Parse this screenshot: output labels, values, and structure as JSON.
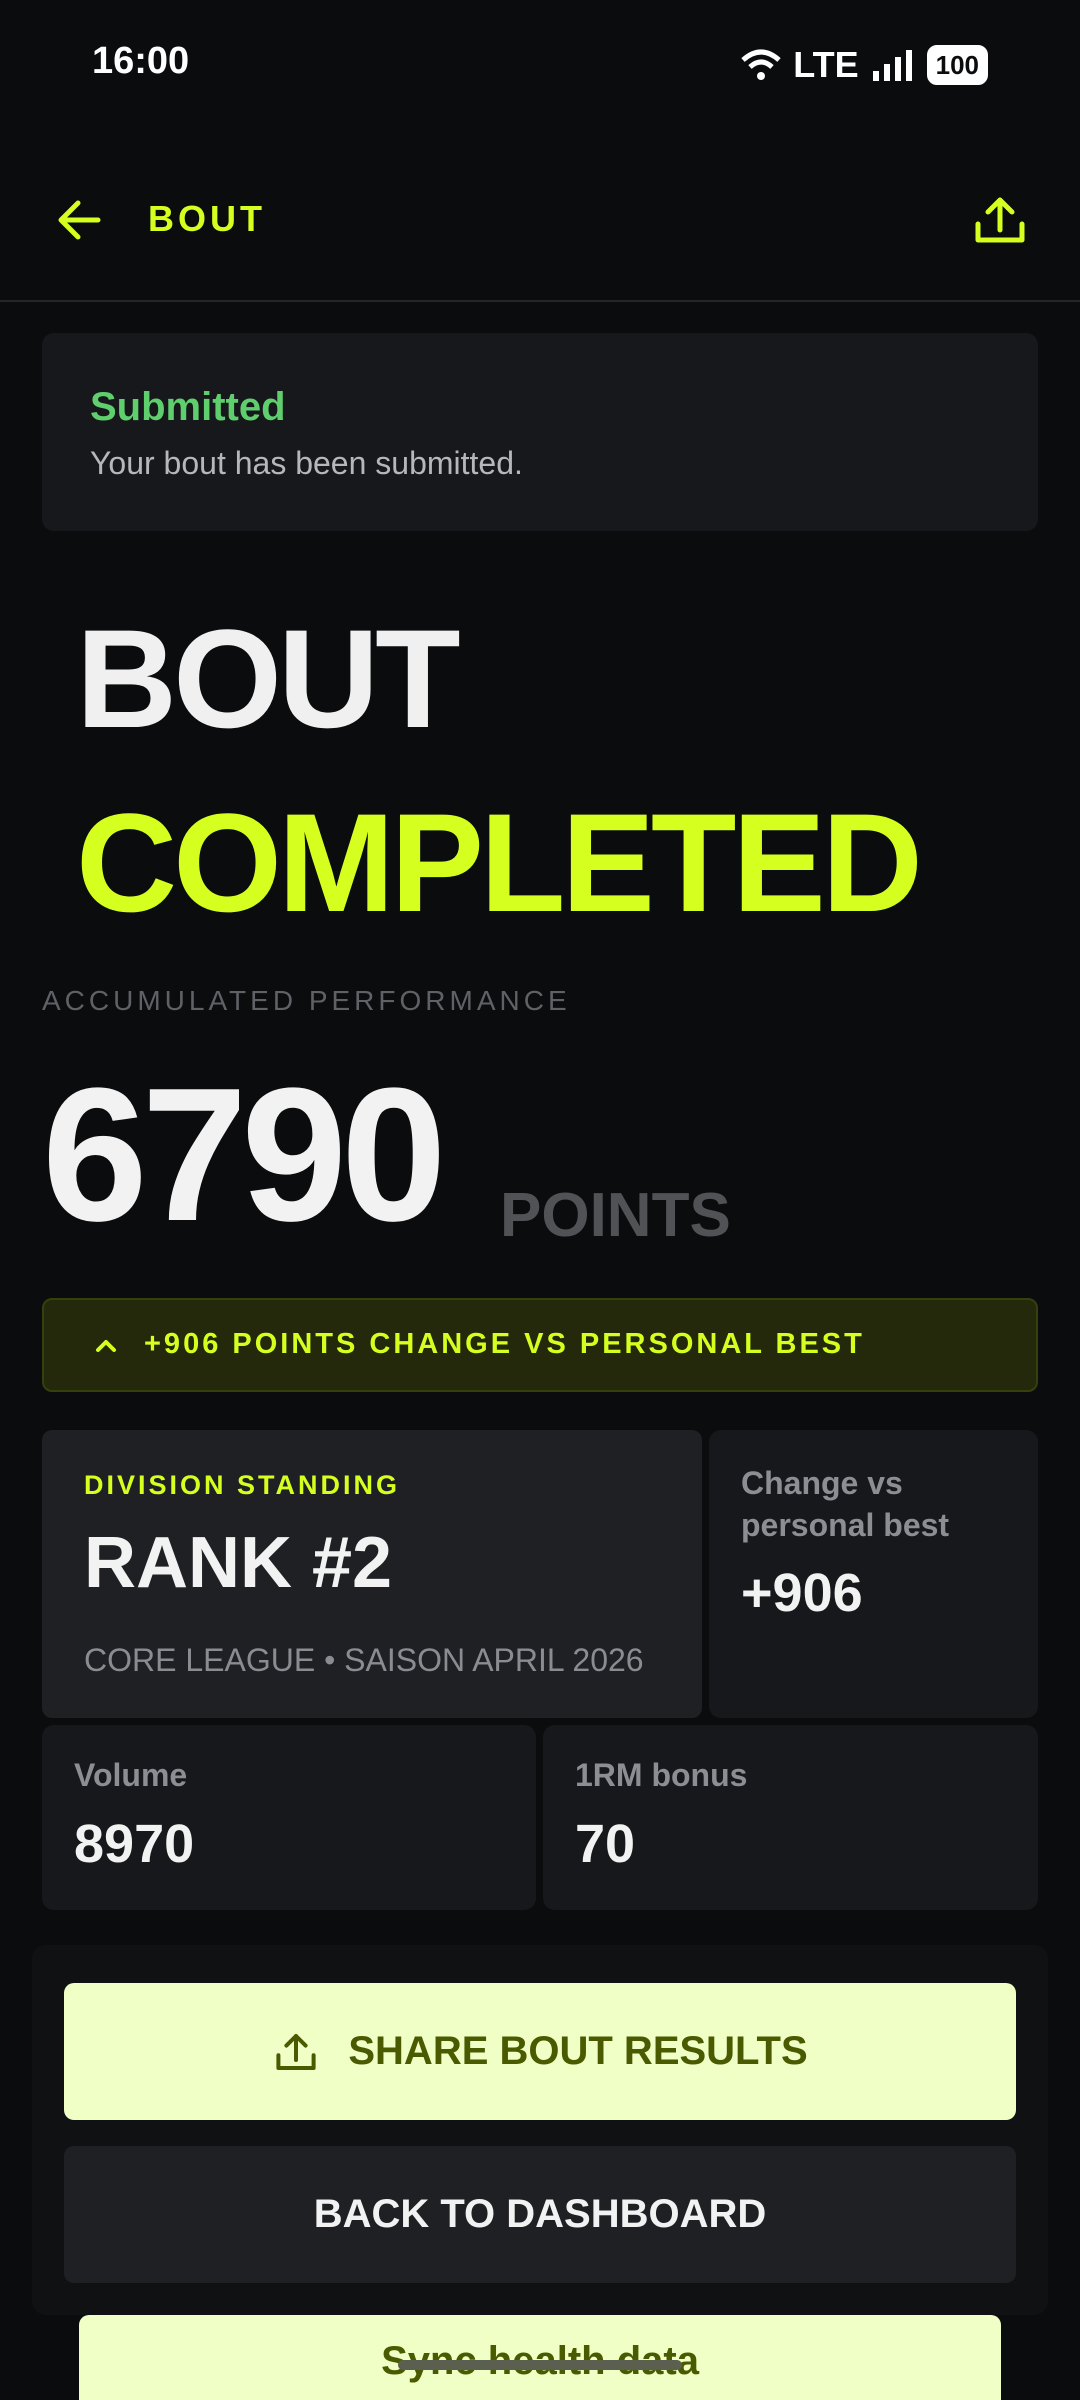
{
  "status_bar": {
    "time": "16:00",
    "network": "LTE",
    "battery": "100"
  },
  "app_bar": {
    "title": "BOUT"
  },
  "submitted": {
    "title": "Submitted",
    "message": "Your bout has been submitted."
  },
  "hero": {
    "line1": "BOUT",
    "line2": "COMPLETED"
  },
  "performance": {
    "label": "ACCUMULATED PERFORMANCE",
    "score": "6790",
    "unit": "POINTS"
  },
  "personal_best_bar": {
    "text": "+906 POINTS CHANGE VS PERSONAL BEST"
  },
  "division": {
    "label": "DIVISION STANDING",
    "rank": "RANK #2",
    "league": "CORE LEAGUE • SAISON APRIL 2026"
  },
  "change_card": {
    "label": "Change vs personal best",
    "value": "+906"
  },
  "volume": {
    "label": "Volume",
    "value": "8970"
  },
  "bonus": {
    "label": "1RM bonus",
    "value": "70"
  },
  "actions": {
    "share": "SHARE BOUT RESULTS",
    "dashboard": "BACK TO DASHBOARD",
    "sync": "Sync health data"
  },
  "colors": {
    "accent": "#d5ff1f",
    "success": "#5fcf6e",
    "background": "#0b0c0e"
  }
}
